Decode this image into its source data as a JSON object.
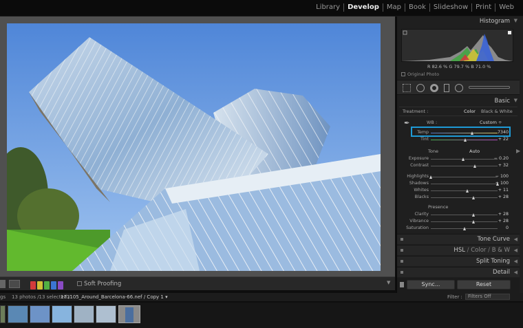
{
  "modules": [
    "Library",
    "Develop",
    "Map",
    "Book",
    "Slideshow",
    "Print",
    "Web"
  ],
  "active_module": "Develop",
  "panel": {
    "histogram_title": "Histogram",
    "histogram_readout": "R  82.6  %  G  79.7  %  B  71.0  %",
    "original_photo_label": "Original Photo",
    "basic_title": "Basic",
    "treatment_label": "Treatment :",
    "treatment_options": [
      "Color",
      "Black & White"
    ],
    "wb_label": "WB :",
    "wb_value": "Custom ÷",
    "tone_label": "Tone",
    "auto_label": "Auto",
    "presence_label": "Presence",
    "sliders": [
      {
        "label": "Temp",
        "value": "7340",
        "level": 0.62,
        "group": "wb"
      },
      {
        "label": "Tint",
        "value": "+ 22",
        "level": 0.52,
        "group": "wb"
      },
      {
        "label": "Exposure",
        "value": "− 0.20",
        "level": 0.48,
        "group": "tone"
      },
      {
        "label": "Contrast",
        "value": "+ 32",
        "level": 0.66,
        "group": "tone"
      },
      {
        "label": "Highlights",
        "value": "− 100",
        "level": 0.0,
        "group": "tone2"
      },
      {
        "label": "Shadows",
        "value": "+ 100",
        "level": 1.0,
        "group": "tone2"
      },
      {
        "label": "Whites",
        "value": "+ 11",
        "level": 0.55,
        "group": "tone2"
      },
      {
        "label": "Blacks",
        "value": "+ 28",
        "level": 0.64,
        "group": "tone2"
      },
      {
        "label": "Clarity",
        "value": "+ 28",
        "level": 0.64,
        "group": "presence"
      },
      {
        "label": "Vibrance",
        "value": "+ 28",
        "level": 0.64,
        "group": "presence"
      },
      {
        "label": "Saturation",
        "value": "0",
        "level": 0.5,
        "group": "presence"
      }
    ],
    "tone_curve": "Tone Curve",
    "hsl": "HSL",
    "hsl_color": "Color",
    "hsl_bw": "B & W",
    "split_toning": "Split Toning",
    "detail": "Detail",
    "sync": "Sync...",
    "reset": "Reset"
  },
  "toolbar": {
    "soft_proofing": "Soft Proofing",
    "color_labels": [
      "#d33b3b",
      "#d2c035",
      "#52b043",
      "#3b76d2",
      "#8a4bc4"
    ]
  },
  "filmbar": {
    "left": "gs",
    "count": "13 photos /13 selected /",
    "path": "171105_Around_Barcelona-66.nef / Copy 1 ▾",
    "filter_label": "Filter :",
    "filter_value": "Filters Off"
  },
  "colors": {
    "highlight": "#1e9bd7",
    "panel_bg": "#1f1f1f"
  }
}
